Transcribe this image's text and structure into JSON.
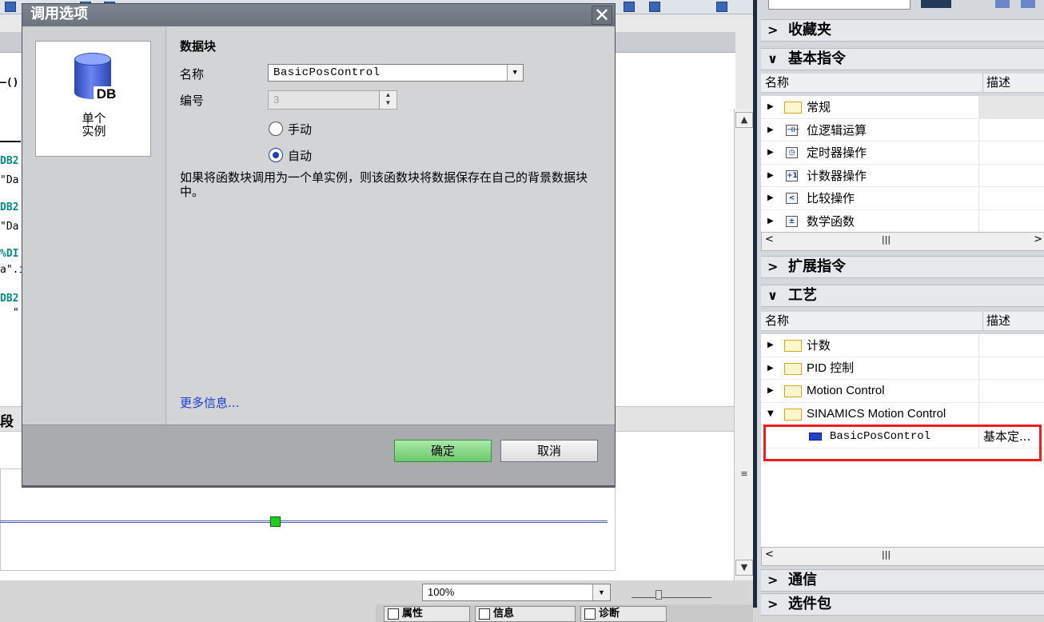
{
  "dialog": {
    "title": "调用选项",
    "close_glyph": "✕",
    "card_db_tag": "DB",
    "card_label_line1": "单个",
    "card_label_line2": "实例",
    "section_title": "数据块",
    "name_label": "名称",
    "name_value": "BasicPosControl",
    "number_label": "编号",
    "number_value": "3",
    "manual_label": "手动",
    "auto_label": "自动",
    "selected_mode": "auto",
    "description": "如果将函数块调用为一个单实例，则该函数块将数据保存在自己的背景数据块中。",
    "more_info": "更多信息...",
    "ok_label": "确定",
    "cancel_label": "取消"
  },
  "editor": {
    "code_fragments": [
      "DB2",
      "\"Da",
      "DB2",
      "\"Da",
      "%DI",
      "a\".i",
      "DB2",
      "\""
    ],
    "partial_left": "—()",
    "segment_label": "段",
    "zoom_value": "100%"
  },
  "bottom_tabs": [
    "属性",
    "信息",
    "诊断"
  ],
  "library": {
    "sections": {
      "favorites": "收藏夹",
      "basic": "基本指令",
      "extended": "扩展指令",
      "technology": "工艺",
      "communication": "通信",
      "optional": "选件包"
    },
    "col_name": "名称",
    "col_desc": "描述",
    "basic_items": [
      {
        "icon": "folder-icon",
        "label": "常规"
      },
      {
        "icon": "bit-logic-icon",
        "glyph": "⊣⊢",
        "label": "位逻辑运算"
      },
      {
        "icon": "timer-icon",
        "glyph": "◷",
        "label": "定时器操作"
      },
      {
        "icon": "counter-icon",
        "glyph": "+1",
        "label": "计数器操作"
      },
      {
        "icon": "compare-icon",
        "glyph": "<",
        "label": "比较操作"
      },
      {
        "icon": "math-icon",
        "glyph": "±",
        "label": "数学函数"
      }
    ],
    "tech_items": [
      {
        "label": "计数"
      },
      {
        "label": "PID 控制"
      },
      {
        "label": "Motion Control"
      },
      {
        "label": "SINAMICS Motion Control"
      }
    ],
    "selected_item": {
      "label": "BasicPosControl",
      "desc": "基本定..."
    }
  }
}
